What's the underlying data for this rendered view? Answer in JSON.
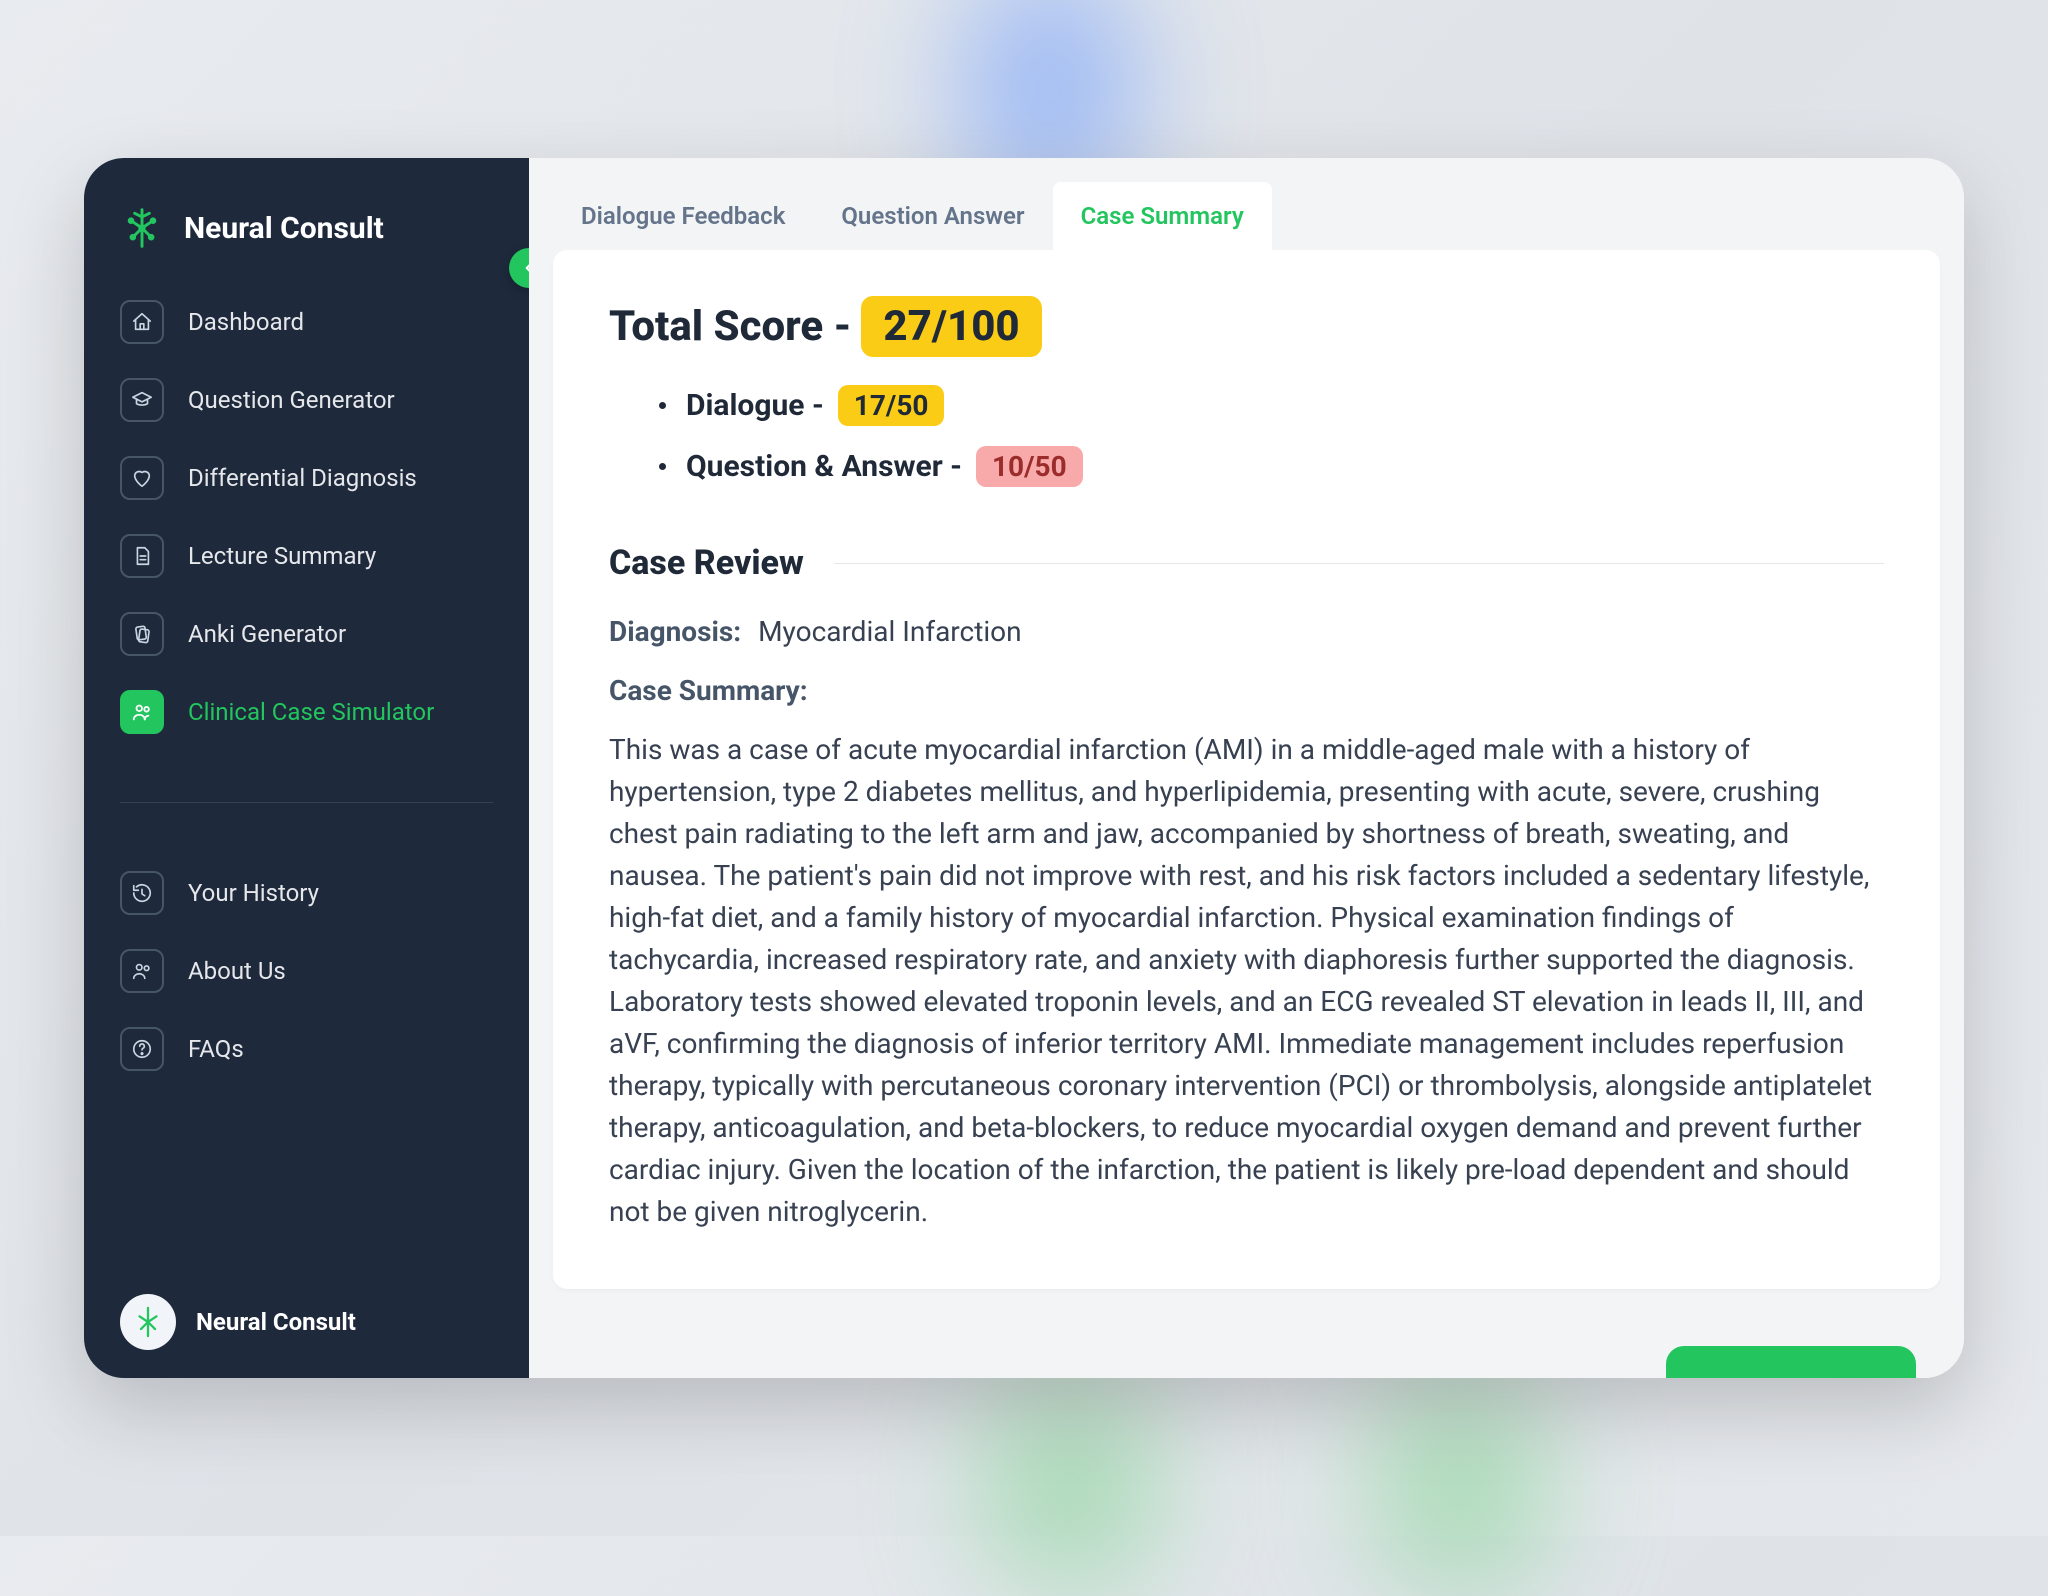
{
  "brand": {
    "name": "Neural Consult"
  },
  "sidebar": {
    "items": [
      {
        "label": "Dashboard"
      },
      {
        "label": "Question Generator"
      },
      {
        "label": "Differential Diagnosis"
      },
      {
        "label": "Lecture Summary"
      },
      {
        "label": "Anki Generator"
      },
      {
        "label": "Clinical Case Simulator"
      }
    ],
    "secondary": [
      {
        "label": "Your History"
      },
      {
        "label": "About Us"
      },
      {
        "label": "FAQs"
      }
    ],
    "footer": {
      "name": "Neural Consult"
    }
  },
  "tabs": [
    {
      "label": "Dialogue Feedback"
    },
    {
      "label": "Question Answer"
    },
    {
      "label": "Case Summary"
    }
  ],
  "scores": {
    "title": "Total Score - ",
    "total": "27/100",
    "dialogue_label": "Dialogue - ",
    "dialogue_value": "17/50",
    "qa_label": "Question & Answer - ",
    "qa_value": "10/50"
  },
  "review": {
    "header": "Case Review",
    "diagnosis_label": "Diagnosis:",
    "diagnosis_value": "Myocardial Infarction",
    "summary_label": "Case Summary:",
    "summary_text": "This was a case of acute myocardial infarction (AMI) in a middle-aged male with a history of hypertension, type 2 diabetes mellitus, and hyperlipidemia, presenting with acute, severe, crushing chest pain radiating to the left arm and jaw, accompanied by shortness of breath, sweating, and nausea. The patient's pain did not improve with rest, and his risk factors included a sedentary lifestyle, high-fat diet, and a family history of myocardial infarction. Physical examination findings of tachycardia, increased respiratory rate, and anxiety with diaphoresis further supported the diagnosis. Laboratory tests showed elevated troponin levels, and an ECG revealed ST elevation in leads II, III, and aVF, confirming the diagnosis of inferior territory AMI. Immediate management includes reperfusion therapy, typically with percutaneous coronary intervention (PCI) or thrombolysis, alongside antiplatelet therapy, anticoagulation, and beta-blockers, to reduce myocardial oxygen demand and prevent further cardiac injury. Given the location of the infarction, the patient is likely pre-load dependent and should not be given nitroglycerin."
  }
}
